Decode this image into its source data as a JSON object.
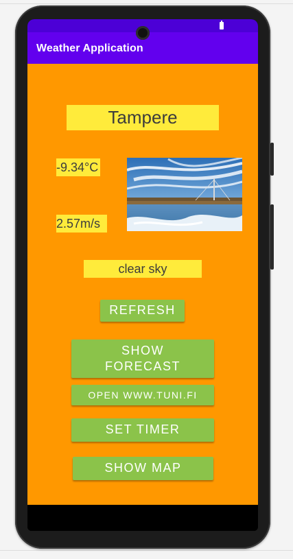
{
  "app": {
    "title": "Weather Application"
  },
  "weather": {
    "city": "Tampere",
    "temperature": "-9.34°C",
    "wind_speed": "2.57m/s",
    "description": "clear sky"
  },
  "buttons": {
    "refresh": "REFRESH",
    "show_forecast": "SHOW FORECAST",
    "open_tuni": "OPEN WWW.TUNI.FI",
    "set_timer": "SET TIMER",
    "show_map": "SHOW MAP"
  },
  "colors": {
    "status_bar": "#4c00d6",
    "app_bar": "#6200ee",
    "background": "#ff9800",
    "label_background": "#ffeb3b",
    "button": "#8bc34a"
  },
  "icons": {
    "status_battery": "battery-icon",
    "camera": "front-camera-icon"
  }
}
